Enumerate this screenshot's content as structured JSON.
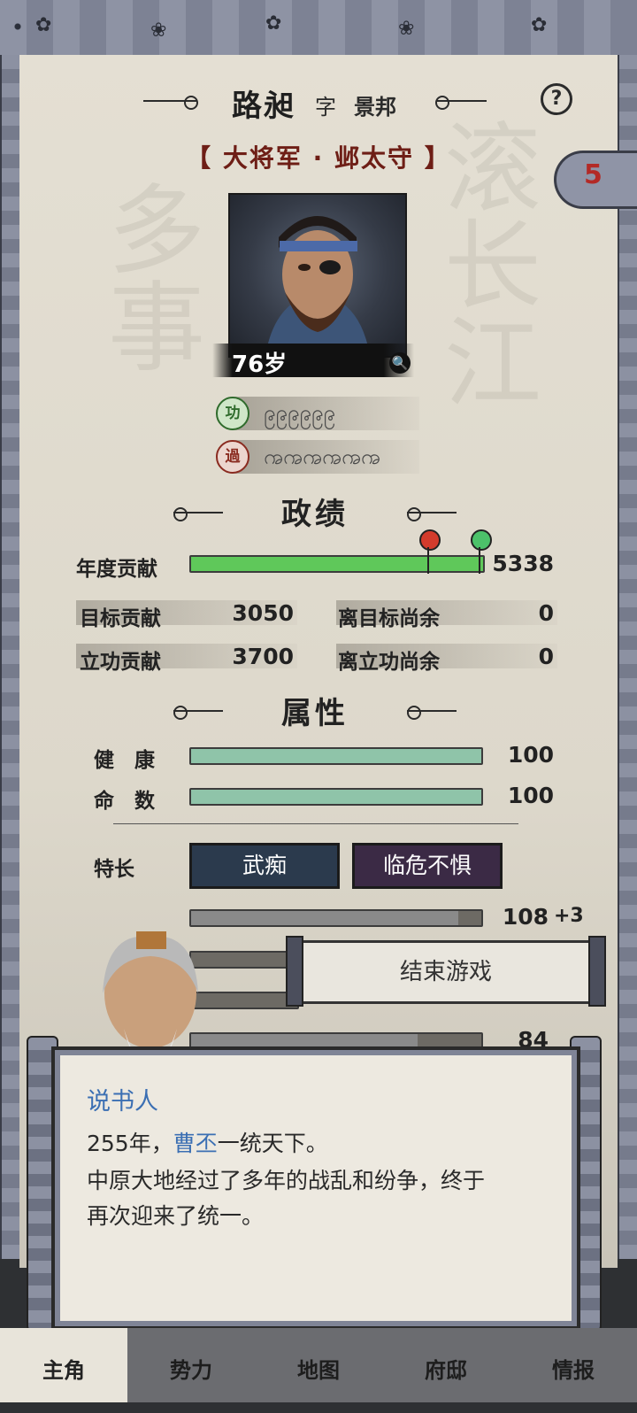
{
  "header": {
    "name": "路昶",
    "zi_label": "字",
    "courtesy_name": "景邦",
    "help_icon": "?",
    "title": "【 大将军 · 邺太守 】",
    "cloud_count": "5"
  },
  "portrait": {
    "age": "76岁",
    "zoom_icon": "magnifier"
  },
  "merit": {
    "gong_badge": "功",
    "gong_beads": "၉၉၉၉၉၉",
    "guo_badge": "過",
    "guo_beads": "ꩠꩠꩠꩠꩠꩠ"
  },
  "achievements": {
    "heading": "政绩",
    "annual_label": "年度贡献",
    "annual_value": "5338",
    "annual_progress": 1.0,
    "target_label": "目标贡献",
    "target_value": "3050",
    "target_remaining_label": "离目标尚余",
    "target_remaining_value": "0",
    "merit_label": "立功贡献",
    "merit_value": "3700",
    "merit_remaining_label": "离立功尚余",
    "merit_remaining_value": "0",
    "colors": {
      "bar": "#5fc85a",
      "target_marker": "#d33b2c",
      "merit_marker": "#4cc26a"
    }
  },
  "attributes": {
    "heading": "属性",
    "health_label": "健　康",
    "health_value": "100",
    "health_fraction": 1.0,
    "fate_label": "命　数",
    "fate_value": "100",
    "fate_fraction": 1.0,
    "bar_color": "#8fc4a9"
  },
  "traits": {
    "label": "特长",
    "items": [
      "武痴",
      "临危不惧"
    ],
    "colors": [
      "#2b3a4d",
      "#3b2a45"
    ]
  },
  "partial_stats": {
    "stat1_value": "108",
    "stat1_bonus": "+3",
    "stat3_value": "",
    "stat4_value": "84"
  },
  "end_game": {
    "label": "结束游戏"
  },
  "dialog": {
    "speaker": "说书人",
    "line1_prefix": "255年，",
    "line1_highlight": "曹丕",
    "line1_suffix": "一统天下。",
    "line2": "中原大地经过了多年的战乱和纷争，终于",
    "line3": "再次迎来了统一。"
  },
  "tabs": {
    "items": [
      "主角",
      "势力",
      "地图",
      "府邸",
      "情报"
    ],
    "active": "主角"
  }
}
